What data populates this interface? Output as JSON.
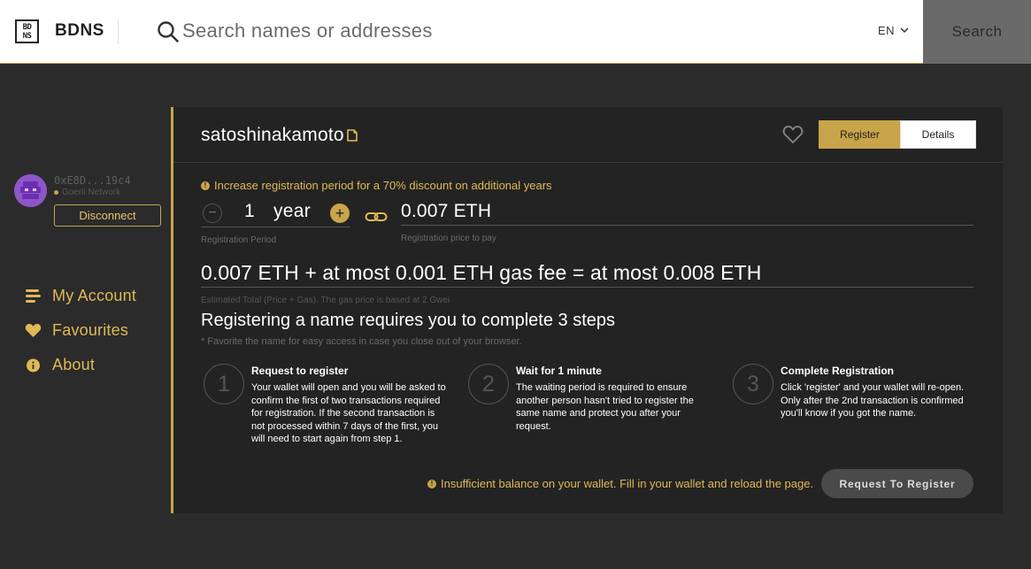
{
  "header": {
    "logo_mark": "BD NS",
    "logo_text": "BDNS",
    "search_placeholder": "Search names or addresses",
    "language": "EN",
    "search_button": "Search"
  },
  "sidebar": {
    "wallet_address": "0xE8D...19c4",
    "network": "Goerli Network",
    "disconnect_label": "Disconnect",
    "nav": [
      {
        "label": "My Account",
        "icon": "account-lines-icon"
      },
      {
        "label": "Favourites",
        "icon": "heart-icon"
      },
      {
        "label": "About",
        "icon": "info-icon"
      }
    ]
  },
  "panel": {
    "name": "satoshinakamoto",
    "tabs": {
      "register": "Register",
      "details": "Details"
    },
    "discount_note": "Increase registration period for a 70% discount on additional years",
    "period": {
      "value": "1",
      "unit": "year",
      "label": "Registration Period"
    },
    "price": {
      "value": "0.007 ETH",
      "label": "Registration price to pay"
    },
    "total": {
      "line": "0.007 ETH + at most 0.001 ETH gas fee = at most 0.008 ETH",
      "note": "Estimated Total (Price + Gas). The gas price is based at 2 Gwei"
    },
    "steps_title": "Registering a name requires you to complete 3 steps",
    "steps_note": "* Favorite the name for easy access in case you close out of your browser.",
    "steps": [
      {
        "num": "1",
        "title": "Request to register",
        "body": "Your wallet will open and you will be asked to confirm the first of two transactions required for registration. If the second transaction is not processed within 7 days of the first, you will need to start again from step 1."
      },
      {
        "num": "2",
        "title": "Wait for 1 minute",
        "body": "The waiting period is required to ensure another person hasn't tried to register the same name and protect you after your request."
      },
      {
        "num": "3",
        "title": "Complete Registration",
        "body": "Click 'register' and your wallet will re-open. Only after the 2nd transaction is confirmed you'll know if you got the name."
      }
    ],
    "balance_note": "Insufficient balance on your wallet. Fill in your wallet and reload the page.",
    "request_button": "Request To Register"
  },
  "colors": {
    "accent": "#c9a44a",
    "background": "#2b2b2b",
    "panel": "#232323"
  }
}
